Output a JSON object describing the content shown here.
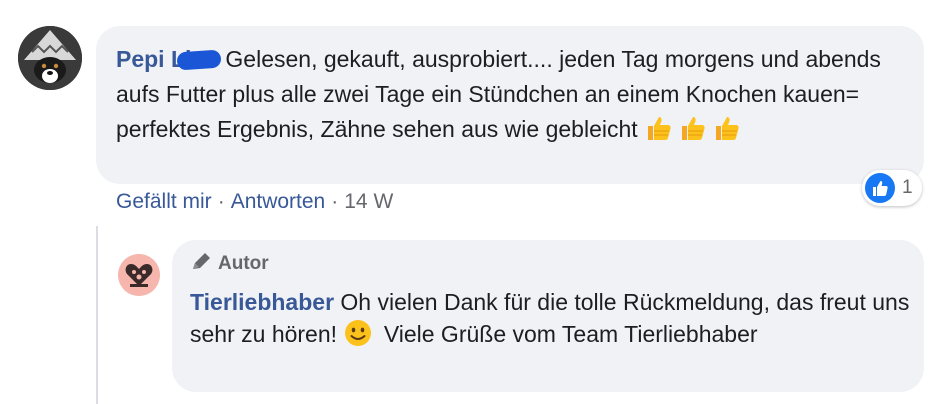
{
  "comment": {
    "author": "Pepi Li",
    "text": "Gelesen, gekauft, ausprobiert.... jeden Tag morgens und abends aufs Futter plus alle zwei Tage ein Stündchen an einem Knochen kauen= perfektes Ergebnis, Zähne sehen aus wie gebleicht",
    "emojis": [
      "thumbs-up",
      "thumbs-up",
      "thumbs-up"
    ],
    "reaction_count": "1",
    "actions": {
      "like": "Gefällt mir",
      "reply": "Antworten",
      "time": "14 W"
    }
  },
  "reply": {
    "badge": "Autor",
    "author": "Tierliebhaber",
    "text_before_emoji": "Oh vielen Dank für die tolle Rückmeldung, das freut uns sehr zu hören!",
    "text_after_emoji": "Viele Grüße vom Team Tierliebhaber",
    "emoji": "smiling-face"
  },
  "colors": {
    "bubble": "#f0f2f5",
    "name": "#385898",
    "meta": "#65676b",
    "like_blue": "#1877f2"
  }
}
